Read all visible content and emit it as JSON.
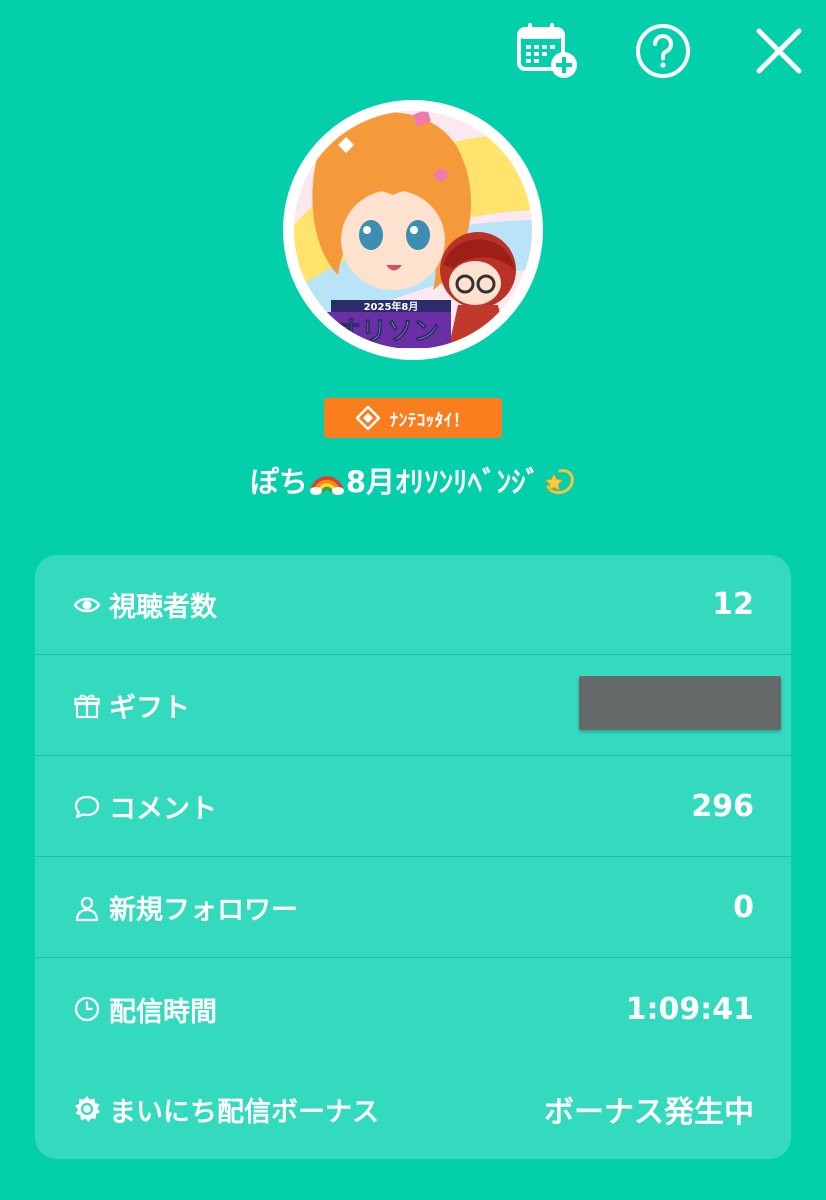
{
  "toolbar": {
    "calendar_icon": "calendar-plus-icon",
    "help_icon": "question-circle-icon",
    "close_icon": "close-icon"
  },
  "badge": {
    "label": "ﾅﾝﾃｺｯﾀｲ！",
    "icon": "diamond-icon",
    "color": "#FB7E1E"
  },
  "stream": {
    "title_part1": "ぽち",
    "title_emoji1": "rainbow",
    "title_part2": "8月ｵﾘｿﾝﾘﾍﾞﾝｼﾞ",
    "title_emoji2": "dizzy-star"
  },
  "avatar": {
    "logo_year_text": "2025年8月",
    "logo_main_text": "オリソン"
  },
  "stats": [
    {
      "icon": "eye-icon",
      "label": "視聴者数",
      "value": "12"
    },
    {
      "icon": "gift-icon",
      "label": "ギフト",
      "value": ""
    },
    {
      "icon": "comment-icon",
      "label": "コメント",
      "value": "296"
    },
    {
      "icon": "person-icon",
      "label": "新規フォロワー",
      "value": "0"
    },
    {
      "icon": "clock-icon",
      "label": "配信時間",
      "value": "1:09:41"
    },
    {
      "icon": "sun-icon",
      "label": "まいにち配信ボーナス",
      "value": "ボーナス発生中"
    }
  ],
  "colors": {
    "background": "#04CFAB",
    "card": "#33DABE",
    "divider": "#14C4A3",
    "accent": "#FB7E1E"
  }
}
